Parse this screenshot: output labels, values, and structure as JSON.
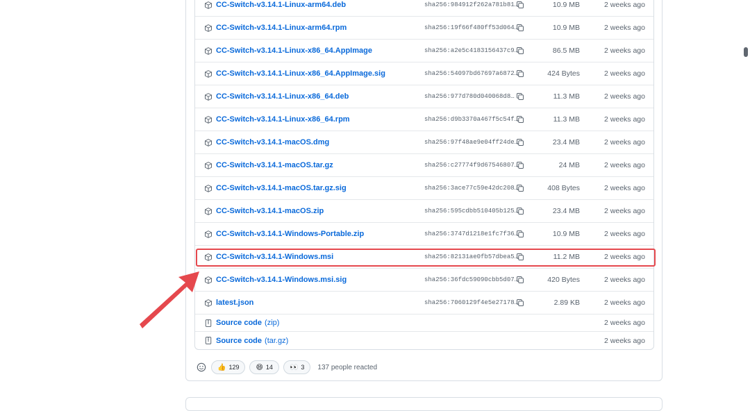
{
  "assets": [
    {
      "name": "CC-Switch-v3.14.1-Linux-arm64.deb",
      "sha": "sha256:984912f262a781b81…",
      "size": "10.9 MB",
      "date": "2 weeks ago"
    },
    {
      "name": "CC-Switch-v3.14.1-Linux-arm64.rpm",
      "sha": "sha256:19f66f480ff53d064…",
      "size": "10.9 MB",
      "date": "2 weeks ago"
    },
    {
      "name": "CC-Switch-v3.14.1-Linux-x86_64.AppImage",
      "sha": "sha256:a2e5c4183156437c9…",
      "size": "86.5 MB",
      "date": "2 weeks ago"
    },
    {
      "name": "CC-Switch-v3.14.1-Linux-x86_64.AppImage.sig",
      "sha": "sha256:54097bd67697a6872…",
      "size": "424 Bytes",
      "date": "2 weeks ago"
    },
    {
      "name": "CC-Switch-v3.14.1-Linux-x86_64.deb",
      "sha": "sha256:977d780d040068d8…",
      "size": "11.3 MB",
      "date": "2 weeks ago"
    },
    {
      "name": "CC-Switch-v3.14.1-Linux-x86_64.rpm",
      "sha": "sha256:d9b3370a467f5c54f…",
      "size": "11.3 MB",
      "date": "2 weeks ago"
    },
    {
      "name": "CC-Switch-v3.14.1-macOS.dmg",
      "sha": "sha256:97f48ae9e04ff24de…",
      "size": "23.4 MB",
      "date": "2 weeks ago"
    },
    {
      "name": "CC-Switch-v3.14.1-macOS.tar.gz",
      "sha": "sha256:c27774f9d67546807…",
      "size": "24 MB",
      "date": "2 weeks ago"
    },
    {
      "name": "CC-Switch-v3.14.1-macOS.tar.gz.sig",
      "sha": "sha256:3ace77c59e42dc208…",
      "size": "408 Bytes",
      "date": "2 weeks ago"
    },
    {
      "name": "CC-Switch-v3.14.1-macOS.zip",
      "sha": "sha256:595cdbb510405b125…",
      "size": "23.4 MB",
      "date": "2 weeks ago"
    },
    {
      "name": "CC-Switch-v3.14.1-Windows-Portable.zip",
      "sha": "sha256:3747d1218e1fc7f36…",
      "size": "10.9 MB",
      "date": "2 weeks ago"
    },
    {
      "name": "CC-Switch-v3.14.1-Windows.msi",
      "sha": "sha256:82131ae0fb57dbea5…",
      "size": "11.2 MB",
      "date": "2 weeks ago"
    },
    {
      "name": "CC-Switch-v3.14.1-Windows.msi.sig",
      "sha": "sha256:36fdc59090cbb5d07…",
      "size": "420 Bytes",
      "date": "2 weeks ago"
    },
    {
      "name": "latest.json",
      "sha": "sha256:7060129f4e5e27178…",
      "size": "2.89 KB",
      "date": "2 weeks ago"
    }
  ],
  "source_code": [
    {
      "label": "Source code",
      "paren": "(zip)",
      "date": "2 weeks ago"
    },
    {
      "label": "Source code",
      "paren": "(tar.gz)",
      "date": "2 weeks ago"
    }
  ],
  "reactions": {
    "items": [
      {
        "emoji": "👍",
        "count": "129"
      },
      {
        "emoji": "😄",
        "count": "14"
      },
      {
        "emoji": "👀",
        "count": "3"
      }
    ],
    "summary": "137 people reacted"
  },
  "colors": {
    "link": "#0969da",
    "highlight": "#e5484d",
    "muted": "#59636e"
  }
}
